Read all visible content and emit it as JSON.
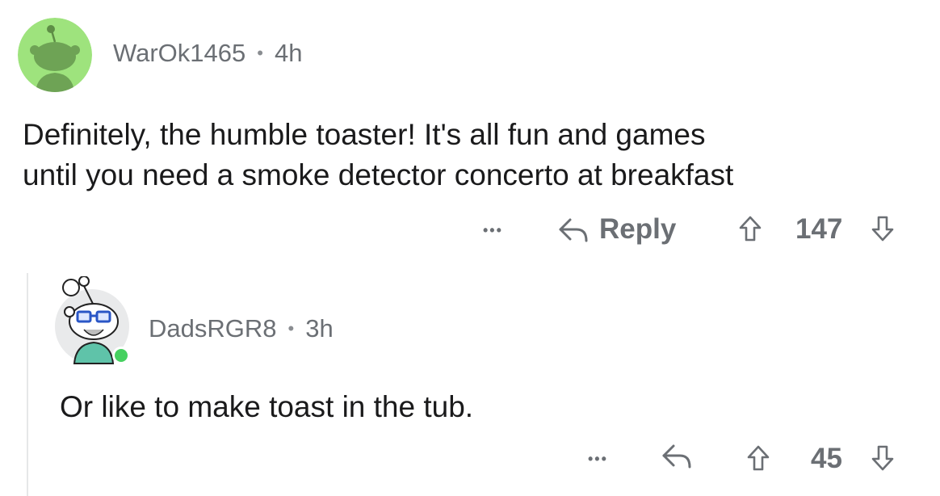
{
  "comment": {
    "author": "WarOk1465",
    "separator": "•",
    "time": "4h",
    "text_line1": "Definitely, the humble toaster! It's all fun and games",
    "text_line2": "until you need a smoke detector concerto at breakfast",
    "more_label": "•••",
    "reply_label": "Reply",
    "score": "147",
    "avatar_color": "#9ee37d"
  },
  "reply": {
    "author": "DadsRGR8",
    "separator": "•",
    "time": "3h",
    "text": "Or like to make toast in the tub.",
    "more_label": "•••",
    "score": "45",
    "online_color": "#46d160"
  },
  "icons": {
    "reply": "reply-arrow-icon",
    "upvote": "upvote-arrow-icon",
    "downvote": "downvote-arrow-icon"
  }
}
